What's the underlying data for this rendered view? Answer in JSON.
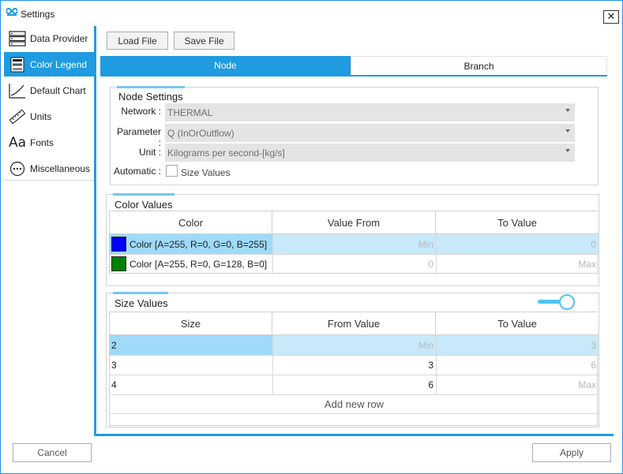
{
  "window": {
    "title": "Settings",
    "close_glyph": "✕"
  },
  "sidebar": {
    "items": [
      {
        "label": "Data Provider",
        "icon": "data-provider-icon"
      },
      {
        "label": "Color Legend",
        "icon": "color-legend-icon"
      },
      {
        "label": "Default Chart",
        "icon": "chart-icon"
      },
      {
        "label": "Units",
        "icon": "ruler-icon"
      },
      {
        "label": "Fonts",
        "icon": "fonts-icon",
        "glyph": "Aa"
      },
      {
        "label": "Miscellaneous",
        "icon": "more-icon"
      }
    ],
    "active_index": 1
  },
  "toolbar": {
    "load_label": "Load File",
    "save_label": "Save File"
  },
  "tabs": [
    {
      "label": "Node"
    },
    {
      "label": "Branch"
    }
  ],
  "node_settings": {
    "title": "Node Settings",
    "network_label": "Network :",
    "network_value": "THERMAL",
    "parameter_label": "Parameter :",
    "parameter_value": "Q (InOrOutflow)",
    "unit_label": "Unit :",
    "unit_value": "Kilograms per second-[kg/s]",
    "automatic_label": "Automatic :",
    "size_values_checkbox_label": "Size Values",
    "size_values_checked": false
  },
  "color_values": {
    "title": "Color Values",
    "headers": [
      "Color",
      "Value From",
      "To Value"
    ],
    "rows": [
      {
        "swatch": "#0000ff",
        "color": "Color [A=255, R=0, G=0, B=255]",
        "from": "Min",
        "to": "0"
      },
      {
        "swatch": "#008000",
        "color": "Color [A=255, R=0, G=128, B=0]",
        "from": "0",
        "to": "Max"
      }
    ]
  },
  "size_values": {
    "title": "Size Values",
    "toggle_on": true,
    "headers": [
      "Size",
      "From Value",
      "To Value"
    ],
    "rows": [
      {
        "size": "2",
        "from": "Min",
        "to": "3"
      },
      {
        "size": "3",
        "from": "3",
        "to": "6"
      },
      {
        "size": "4",
        "from": "6",
        "to": "Max"
      }
    ],
    "add_row_label": "Add new row"
  },
  "footer": {
    "cancel_label": "Cancel",
    "apply_label": "Apply"
  },
  "colors": {
    "accent": "#1e9be1",
    "selection": "#9fdaf9",
    "toggle": "#4fc3f7"
  }
}
